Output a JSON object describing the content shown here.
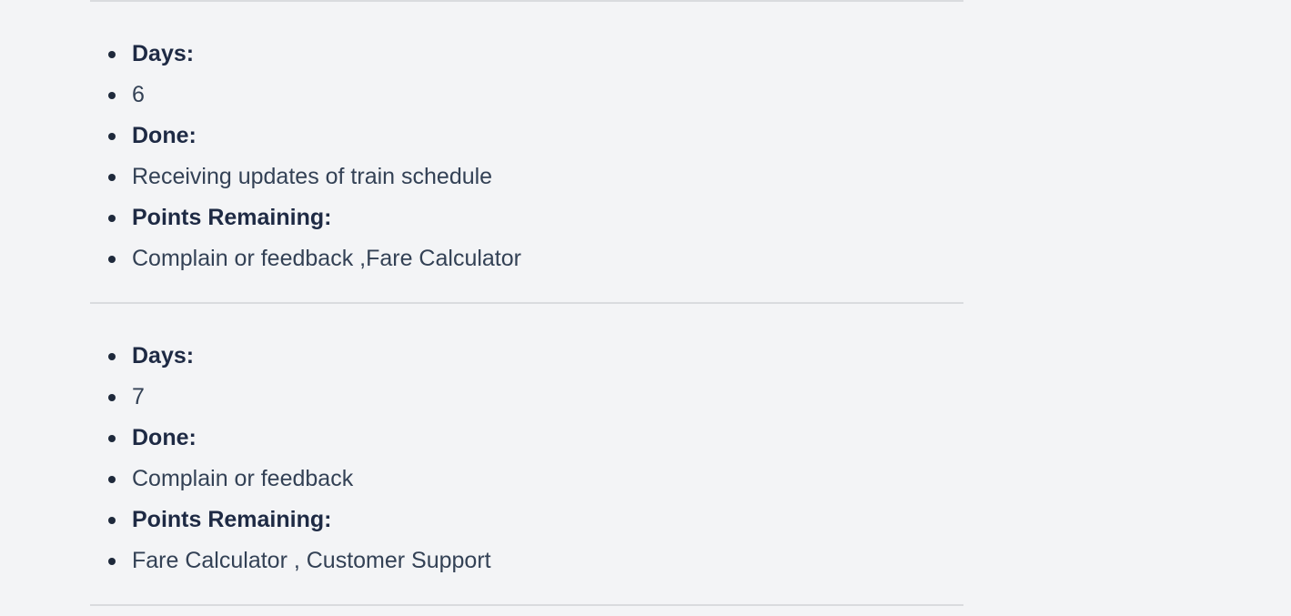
{
  "entries": [
    {
      "days_label": "Days:",
      "days_value": "6",
      "done_label": "Done:",
      "done_value": "Receiving updates of train schedule",
      "remaining_label": "Points Remaining:",
      "remaining_value": "Complain or feedback ,Fare Calculator"
    },
    {
      "days_label": "Days:",
      "days_value": "7",
      "done_label": "Done:",
      "done_value": "Complain or feedback",
      "remaining_label": "Points Remaining:",
      "remaining_value": "Fare Calculator , Customer Support"
    }
  ]
}
